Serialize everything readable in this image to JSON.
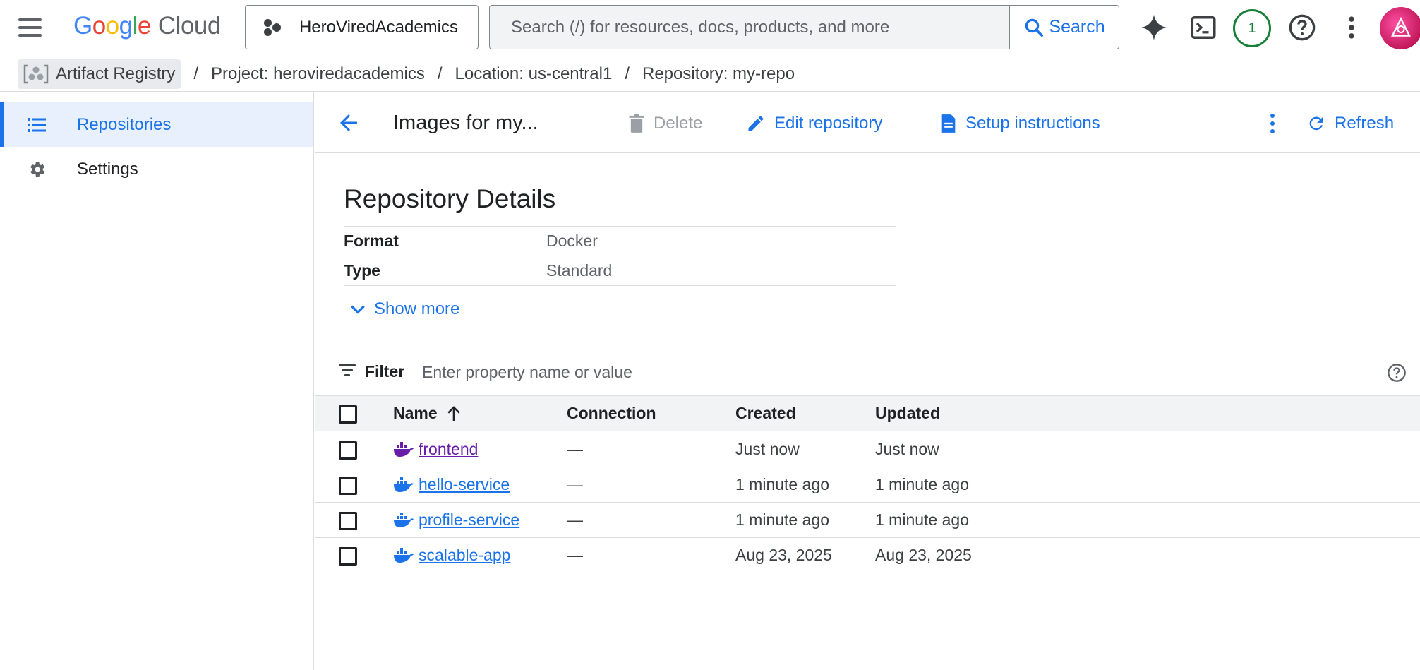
{
  "header": {
    "logo": {
      "g1": "G",
      "o1": "o",
      "o2": "o",
      "g2": "g",
      "l": "l",
      "e": "e",
      "product": "Cloud"
    },
    "project_name": "HeroViredAcademics",
    "search_placeholder": "Search (/) for resources, docs, products, and more",
    "search_button": "Search",
    "notifications_count": "1",
    "colors": {
      "accent": "#1a73e8",
      "badge": "#188038",
      "visited_link": "#681da8"
    }
  },
  "breadcrumb": {
    "product": "Artifact Registry",
    "project": "Project: herovired​academics",
    "location": "Location: us-central1",
    "repository": "Repository: my-repo",
    "separator": "/"
  },
  "sidebar": {
    "items": [
      {
        "label": "Repositories",
        "icon": "list-icon",
        "active": true
      },
      {
        "label": "Settings",
        "icon": "gear-icon",
        "active": false
      }
    ]
  },
  "toolbar": {
    "title": "Images for my...",
    "delete_label": "Delete",
    "edit_label": "Edit repository",
    "setup_label": "Setup instructions",
    "refresh_label": "Refresh"
  },
  "details": {
    "title": "Repository Details",
    "rows": [
      {
        "key": "Format",
        "value": "Docker"
      },
      {
        "key": "Type",
        "value": "Standard"
      }
    ],
    "show_more": "Show more"
  },
  "filter": {
    "label": "Filter",
    "placeholder": "Enter property name or value"
  },
  "table": {
    "columns": {
      "name": "Name",
      "connection": "Connection",
      "created": "Created",
      "updated": "Updated"
    },
    "sort": "ascending",
    "rows": [
      {
        "name": "frontend",
        "connection": "—",
        "created": "Just now",
        "updated": "Just now",
        "visited": true
      },
      {
        "name": "hello-service",
        "connection": "—",
        "created": "1 minute ago",
        "updated": "1 minute ago",
        "visited": false
      },
      {
        "name": "profile-service",
        "connection": "—",
        "created": "1 minute ago",
        "updated": "1 minute ago",
        "visited": false
      },
      {
        "name": "scalable-app",
        "connection": "—",
        "created": "Aug 23, 2025",
        "updated": "Aug 23, 2025",
        "visited": false
      }
    ]
  }
}
